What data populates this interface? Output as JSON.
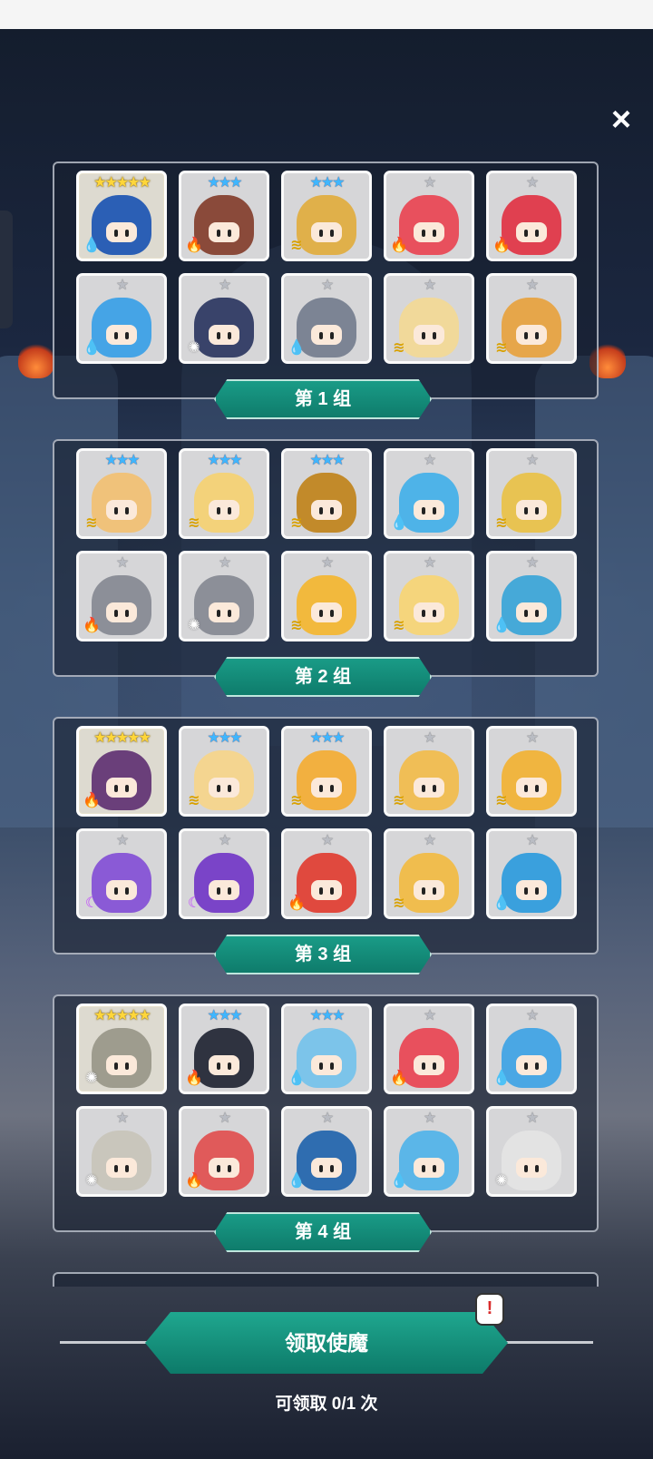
{
  "close_icon": "×",
  "groups": [
    {
      "label": "第 1 组",
      "cards": [
        {
          "stars": "★★★★★",
          "tier": "s5",
          "element": "water",
          "color": "#2b5fb5"
        },
        {
          "stars": "★★★",
          "tier": "s3",
          "element": "fire",
          "color": "#8a4a3a"
        },
        {
          "stars": "★★★",
          "tier": "s3",
          "element": "wind",
          "color": "#e0b04a"
        },
        {
          "stars": "★",
          "tier": "s1",
          "element": "fire",
          "color": "#e8505d"
        },
        {
          "stars": "★",
          "tier": "s1",
          "element": "fire",
          "color": "#e04050"
        },
        {
          "stars": "★",
          "tier": "s1",
          "element": "water",
          "color": "#45a4e6"
        },
        {
          "stars": "★",
          "tier": "s1",
          "element": "light",
          "color": "#39436a"
        },
        {
          "stars": "★",
          "tier": "s1",
          "element": "water",
          "color": "#7c8494"
        },
        {
          "stars": "★",
          "tier": "s1",
          "element": "wind",
          "color": "#f1d99a"
        },
        {
          "stars": "★",
          "tier": "s1",
          "element": "wind",
          "color": "#e6a64a"
        }
      ]
    },
    {
      "label": "第 2 组",
      "cards": [
        {
          "stars": "★★★",
          "tier": "s3",
          "element": "wind",
          "color": "#f0c27a"
        },
        {
          "stars": "★★★",
          "tier": "s3",
          "element": "wind",
          "color": "#f3d27a"
        },
        {
          "stars": "★★★",
          "tier": "s3",
          "element": "wind",
          "color": "#c28a2a"
        },
        {
          "stars": "★",
          "tier": "s1",
          "element": "water",
          "color": "#4eb3e8"
        },
        {
          "stars": "★",
          "tier": "s1",
          "element": "wind",
          "color": "#e8c352"
        },
        {
          "stars": "★",
          "tier": "s1",
          "element": "fire",
          "color": "#8c8f98"
        },
        {
          "stars": "★",
          "tier": "s1",
          "element": "light",
          "color": "#8c8f98"
        },
        {
          "stars": "★",
          "tier": "s1",
          "element": "wind",
          "color": "#f2b93d"
        },
        {
          "stars": "★",
          "tier": "s1",
          "element": "wind",
          "color": "#f5d57c"
        },
        {
          "stars": "★",
          "tier": "s1",
          "element": "water",
          "color": "#46a9d8"
        }
      ]
    },
    {
      "label": "第 3 组",
      "cards": [
        {
          "stars": "★★★★★",
          "tier": "s5",
          "element": "fire",
          "color": "#6a3f7a"
        },
        {
          "stars": "★★★",
          "tier": "s3",
          "element": "wind",
          "color": "#f4d590"
        },
        {
          "stars": "★★★",
          "tier": "s3",
          "element": "wind",
          "color": "#f2b040"
        },
        {
          "stars": "★",
          "tier": "s1",
          "element": "wind",
          "color": "#f0be56"
        },
        {
          "stars": "★",
          "tier": "s1",
          "element": "wind",
          "color": "#f0b540"
        },
        {
          "stars": "★",
          "tier": "s1",
          "element": "dark",
          "color": "#8a5ad6"
        },
        {
          "stars": "★",
          "tier": "s1",
          "element": "dark",
          "color": "#7a44c8"
        },
        {
          "stars": "★",
          "tier": "s1",
          "element": "fire",
          "color": "#e0493e"
        },
        {
          "stars": "★",
          "tier": "s1",
          "element": "wind",
          "color": "#f0bd4e"
        },
        {
          "stars": "★",
          "tier": "s1",
          "element": "water",
          "color": "#3aa0dd"
        }
      ]
    },
    {
      "label": "第 4 组",
      "cards": [
        {
          "stars": "★★★★★",
          "tier": "s5",
          "element": "light",
          "color": "#9e9c8e"
        },
        {
          "stars": "★★★",
          "tier": "s3",
          "element": "fire",
          "color": "#2f3340"
        },
        {
          "stars": "★★★",
          "tier": "s3",
          "element": "water",
          "color": "#7cc4ea"
        },
        {
          "stars": "★",
          "tier": "s1",
          "element": "fire",
          "color": "#e8505d"
        },
        {
          "stars": "★",
          "tier": "s1",
          "element": "water",
          "color": "#4aa7e4"
        },
        {
          "stars": "★",
          "tier": "s1",
          "element": "light",
          "color": "#c9c6bc"
        },
        {
          "stars": "★",
          "tier": "s1",
          "element": "fire",
          "color": "#e05a5a"
        },
        {
          "stars": "★",
          "tier": "s1",
          "element": "water",
          "color": "#2f6db0"
        },
        {
          "stars": "★",
          "tier": "s1",
          "element": "water",
          "color": "#5bb6e8"
        },
        {
          "stars": "★",
          "tier": "s1",
          "element": "light",
          "color": "#e3e3e3"
        }
      ]
    }
  ],
  "claim_button": "领取使魔",
  "alert_badge": "!",
  "claim_count": "可领取 0/1 次",
  "element_glyphs": {
    "water": "💧",
    "fire": "🔥",
    "wind": "≋",
    "light": "✺",
    "dark": "☾"
  }
}
